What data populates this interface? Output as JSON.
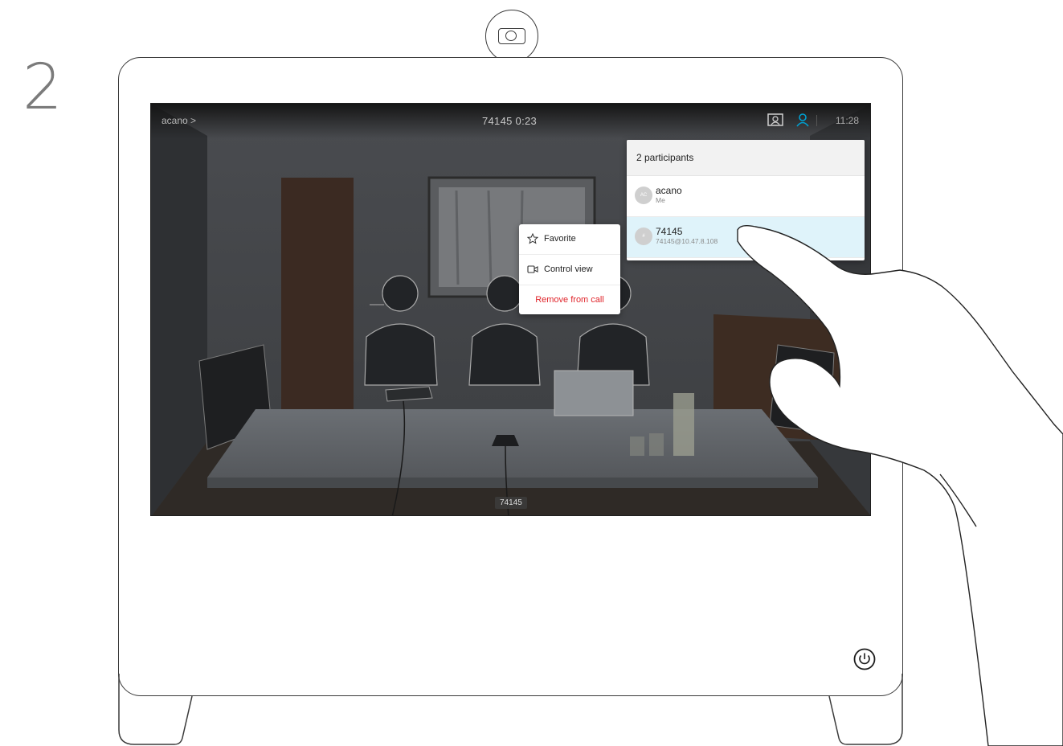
{
  "step_number": "2",
  "call": {
    "caller_label": "acano >",
    "remote_info": "74145  0:23",
    "clock": "11:28",
    "screen_label": "74145"
  },
  "participants_panel": {
    "title": "2 participants",
    "participants": [
      {
        "initials": "AC",
        "name": "acano",
        "detail": "Me"
      },
      {
        "initials": "#",
        "name": "74145",
        "detail": "74145@10.47.8.108"
      }
    ]
  },
  "context_menu": {
    "favorite_label": "Favorite",
    "control_view_label": "Control view",
    "remove_label": "Remove from call"
  },
  "colors": {
    "accent": "#00a0d1",
    "danger": "#e0252b",
    "selected_row": "#dff3fa"
  },
  "icons": {
    "camera": "camera-icon",
    "layout": "layout-icon",
    "participants": "participants-icon",
    "favorite": "star-icon",
    "control_view": "video-camera-icon",
    "power": "power-icon"
  }
}
